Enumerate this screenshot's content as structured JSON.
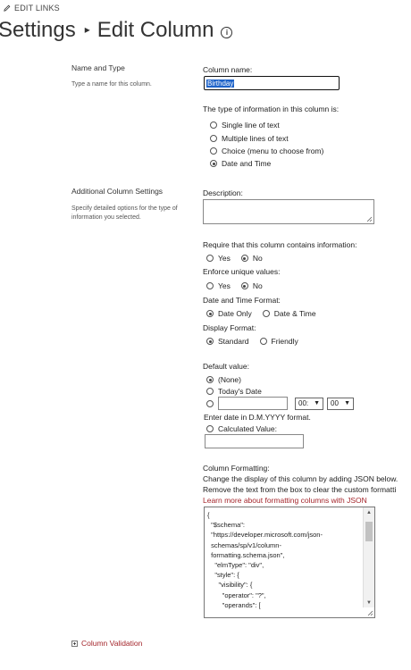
{
  "top": {
    "edit_links": "EDIT LINKS",
    "breadcrumb": "Settings",
    "separator": "▸",
    "page_title": "Edit Column"
  },
  "name_type": {
    "heading": "Name and Type",
    "description": "Type a name for this column.",
    "column_name_label": "Column name:",
    "column_name_value": "Birthday",
    "type_label": "The type of information in this column is:",
    "type_options": [
      {
        "label": "Single line of text",
        "selected": false
      },
      {
        "label": "Multiple lines of text",
        "selected": false
      },
      {
        "label": "Choice (menu to choose from)",
        "selected": false
      },
      {
        "label": "Date and Time",
        "selected": true
      }
    ]
  },
  "additional": {
    "heading": "Additional Column Settings",
    "description": "Specify detailed options for the type of information you selected.",
    "description_label": "Description:",
    "require_label": "Require that this column contains information:",
    "require_yes": "Yes",
    "require_no": "No",
    "unique_label": "Enforce unique values:",
    "unique_yes": "Yes",
    "unique_no": "No",
    "format_label": "Date and Time Format:",
    "format_date_only": "Date Only",
    "format_date_time": "Date & Time",
    "display_label": "Display Format:",
    "display_standard": "Standard",
    "display_friendly": "Friendly",
    "default_label": "Default value:",
    "default_none": "(None)",
    "default_today": "Today's Date",
    "hour_value": "00:",
    "minute_value": "00",
    "date_hint": "Enter date in D.M.YYYY format.",
    "calculated_label": "Calculated Value:"
  },
  "formatting": {
    "heading": "Column Formatting:",
    "line1": "Change the display of this column by adding JSON below.",
    "line2": "Remove the text from the box to clear the custom formatti",
    "learn_more": "Learn more about formatting columns with JSON",
    "json": "{\n  \"$schema\":\n  \"https://developer.microsoft.com/json-\n  schemas/sp/v1/column-\n  formatting.schema.json\",\n    \"elmType\": \"div\",\n    \"style\": {\n      \"visibility\": {\n        \"operator\": \"?\",\n        \"operands\": ["
  },
  "validation": {
    "label": "Column Validation"
  },
  "colors": {
    "link": "#a4262c",
    "selection": "#1e63c9"
  }
}
